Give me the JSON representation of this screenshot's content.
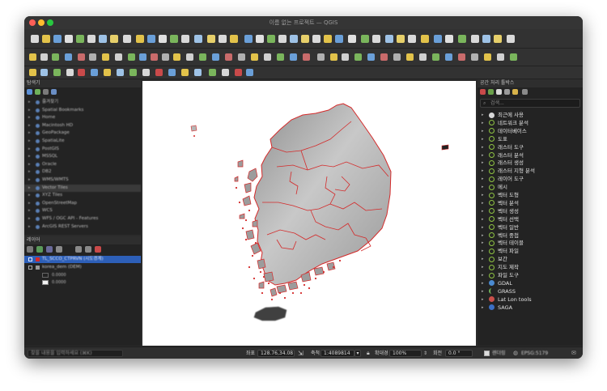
{
  "window": {
    "title": "이름 없는 프로젝트 — QGIS"
  },
  "layers_panel": {
    "title": "탐색기",
    "browser_items": [
      {
        "label": "즐겨찾기"
      },
      {
        "label": "Spatial Bookmarks"
      },
      {
        "label": "Home"
      },
      {
        "label": "Macintosh HD"
      },
      {
        "label": "GeoPackage"
      },
      {
        "label": "SpatiaLite"
      },
      {
        "label": "PostGIS"
      },
      {
        "label": "MSSQL"
      },
      {
        "label": "Oracle"
      },
      {
        "label": "DB2"
      },
      {
        "label": "WMS/WMTS"
      },
      {
        "label": "Vector Tiles"
      },
      {
        "label": "XYZ Tiles"
      },
      {
        "label": "OpenStreetMap"
      },
      {
        "label": "WCS"
      },
      {
        "label": "WFS / OGC API - Features"
      },
      {
        "label": "ArcGIS REST Servers"
      }
    ],
    "layers_title": "레이어",
    "layers": [
      {
        "label": "TL_SCCO_CTPRVN (시도경계)"
      },
      {
        "label": "korea_dem (DEM)"
      },
      {
        "label": "0.0000"
      },
      {
        "label": "0.0000"
      }
    ]
  },
  "toolbox": {
    "title": "공간 처리 툴박스",
    "search_placeholder": "검색...",
    "items": [
      {
        "label": "최근에 사용"
      },
      {
        "label": "네트워크 분석"
      },
      {
        "label": "데이터베이스"
      },
      {
        "label": "도표"
      },
      {
        "label": "래스터 도구"
      },
      {
        "label": "래스터 분석"
      },
      {
        "label": "래스터 생성"
      },
      {
        "label": "래스터 지형 분석"
      },
      {
        "label": "레이어 도구"
      },
      {
        "label": "메시"
      },
      {
        "label": "벡터 도형"
      },
      {
        "label": "벡터 분석"
      },
      {
        "label": "벡터 생성"
      },
      {
        "label": "벡터 선택"
      },
      {
        "label": "벡터 일반"
      },
      {
        "label": "벡터 중첩"
      },
      {
        "label": "벡터 테이블"
      },
      {
        "label": "벡터 파일"
      },
      {
        "label": "보간"
      },
      {
        "label": "지도 제작"
      },
      {
        "label": "파일 도구"
      },
      {
        "label": "GDAL"
      },
      {
        "label": "GRASS"
      },
      {
        "label": "Lat Lon tools"
      },
      {
        "label": "SAGA"
      }
    ]
  },
  "status_bar": {
    "locator_placeholder": "찾을 내용을 입력하세요 (⌘K)",
    "coordinate_label": "좌표",
    "coordinate_value": "128.76,34.08",
    "scale_label": "축척",
    "scale_value": "1:4089814",
    "magnifier_label": "확대경",
    "magnifier_value": "100%",
    "rotation_label": "회전",
    "rotation_value": "0.0 °",
    "render_label": "렌더링",
    "crs_label": "EPSG:5179"
  },
  "map": {
    "boundary_color": "#d42a2a",
    "land_color": "#b4b4b4",
    "background_color": "#ffffff"
  }
}
